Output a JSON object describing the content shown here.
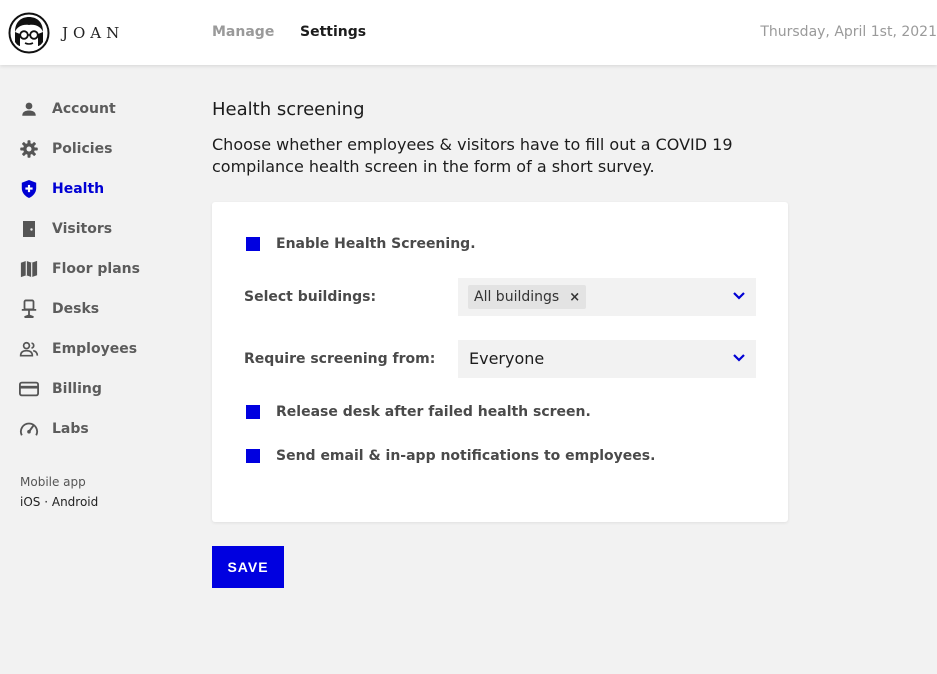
{
  "header": {
    "logo_text": "JOAN",
    "tabs": [
      {
        "label": "Manage",
        "active": false
      },
      {
        "label": "Settings",
        "active": true
      }
    ],
    "date": "Thursday, April 1st, 2021"
  },
  "sidebar": {
    "items": [
      {
        "label": "Account",
        "icon": "person-icon"
      },
      {
        "label": "Policies",
        "icon": "gear-icon"
      },
      {
        "label": "Health",
        "icon": "shield-plus-icon",
        "active": true
      },
      {
        "label": "Visitors",
        "icon": "door-icon"
      },
      {
        "label": "Floor plans",
        "icon": "map-icon"
      },
      {
        "label": "Desks",
        "icon": "chair-icon"
      },
      {
        "label": "Employees",
        "icon": "people-icon"
      },
      {
        "label": "Billing",
        "icon": "credit-card-icon"
      },
      {
        "label": "Labs",
        "icon": "speedometer-icon"
      }
    ],
    "mobile_app_label": "Mobile app",
    "mobile_links": [
      "iOS",
      "Android"
    ],
    "mobile_separator": " · "
  },
  "main": {
    "title": "Health screening",
    "description": "Choose whether employees & visitors have to fill out a COVID 19 compilance health screen in the form of a short survey.",
    "enable_label": "Enable Health Screening.",
    "enable_checked": true,
    "buildings_label": "Select buildings:",
    "buildings_selected": [
      "All buildings"
    ],
    "screening_from_label": "Require screening from:",
    "screening_from_value": "Everyone",
    "release_desk_label": "Release desk after failed health screen.",
    "release_desk_checked": true,
    "notify_label": "Send email & in-app notifications to employees.",
    "notify_checked": true,
    "save_label": "SAVE"
  },
  "colors": {
    "accent": "#0000e0",
    "active_nav": "#0000d4",
    "background": "#f2f2f2"
  }
}
